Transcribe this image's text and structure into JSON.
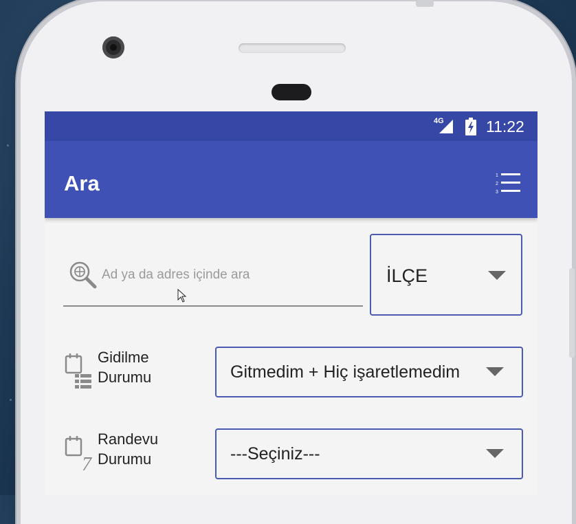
{
  "status_bar": {
    "network": "4G",
    "time": "11:22"
  },
  "app_bar": {
    "title": "Ara",
    "menu_icon": "numbered-list-icon"
  },
  "search": {
    "placeholder": "Ad ya da adres içinde ara",
    "value": "",
    "icon": "search-icon"
  },
  "district_select": {
    "label": "İLÇE"
  },
  "visit_status": {
    "label_line1": "Gidilme",
    "label_line2": "Durumu",
    "selected": "Gitmedim + Hiç işaretlemedim",
    "icon": "calendar-list-icon"
  },
  "appointment_status": {
    "label_line1": "Randevu",
    "label_line2": "Durumu",
    "selected": "---Seçiniz---",
    "icon": "calendar-7-icon"
  },
  "colors": {
    "status_bar": "#3747a6",
    "app_bar": "#3f51b5",
    "border_accent": "#4a59b2",
    "screen_bg": "#f4f4f4"
  }
}
